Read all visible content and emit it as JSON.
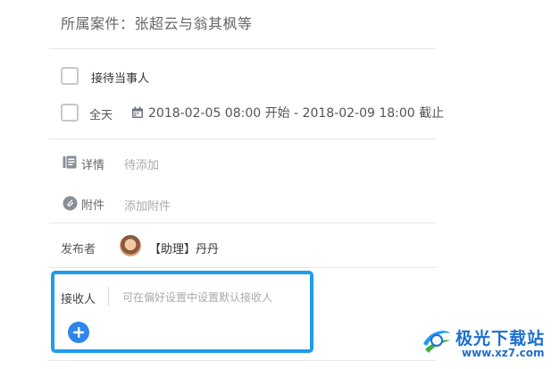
{
  "case": {
    "label": "所属案件：张超云与翁其枫等"
  },
  "reception": {
    "label": "接待当事人",
    "checked": false
  },
  "allday": {
    "label": "全天",
    "checked": false,
    "date_range": "2018-02-05 08:00 开始 - 2018-02-09 18:00 截止"
  },
  "details": {
    "label": "详情",
    "placeholder": "待添加"
  },
  "attachment": {
    "label": "附件",
    "placeholder": "添加附件"
  },
  "publisher": {
    "label": "发布者",
    "name": "【助理】丹丹"
  },
  "receiver": {
    "label": "接收人",
    "hint": "可在偏好设置中设置默认接收人"
  },
  "watermark": {
    "brand": "极光下载站",
    "url": "www.xz7.com"
  },
  "colors": {
    "highlight": "#1e9cf0",
    "add_button": "#2f86e8",
    "divider": "#e6e6e6"
  }
}
